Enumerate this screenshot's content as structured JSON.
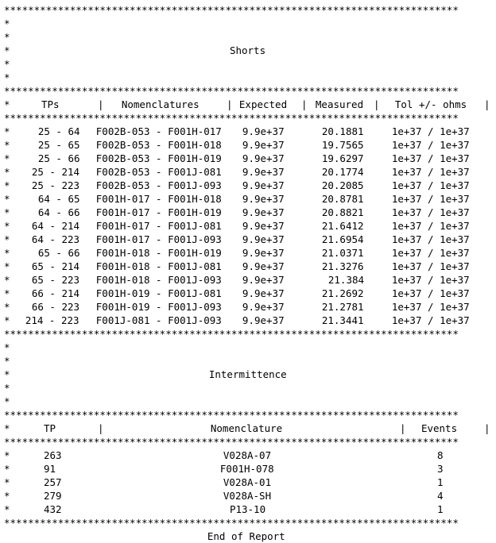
{
  "document": {
    "separator_char": "*",
    "separator_text": "****************************************************************************",
    "row_marker": "*",
    "footer": "End of Report",
    "text_color": "#000000",
    "background_color": "#ffffff"
  },
  "shorts_section": {
    "title": "Shorts",
    "headers": {
      "tps": "TPs",
      "nomenclatures": "Nomenclatures",
      "expected": "Expected",
      "measured": "Measured",
      "tolerance": "Tol +/- ohms"
    },
    "rows": [
      {
        "tps": "25 - 64",
        "nomenclatures": "F002B-053 - F001H-017",
        "expected": "9.9e+37",
        "measured": "20.1881",
        "tolerance": "1e+37 / 1e+37"
      },
      {
        "tps": "25 - 65",
        "nomenclatures": "F002B-053 - F001H-018",
        "expected": "9.9e+37",
        "measured": "19.7565",
        "tolerance": "1e+37 / 1e+37"
      },
      {
        "tps": "25 - 66",
        "nomenclatures": "F002B-053 - F001H-019",
        "expected": "9.9e+37",
        "measured": "19.6297",
        "tolerance": "1e+37 / 1e+37"
      },
      {
        "tps": "25 - 214",
        "nomenclatures": "F002B-053 - F001J-081",
        "expected": "9.9e+37",
        "measured": "20.1774",
        "tolerance": "1e+37 / 1e+37"
      },
      {
        "tps": "25 - 223",
        "nomenclatures": "F002B-053 - F001J-093",
        "expected": "9.9e+37",
        "measured": "20.2085",
        "tolerance": "1e+37 / 1e+37"
      },
      {
        "tps": "64 - 65",
        "nomenclatures": "F001H-017 - F001H-018",
        "expected": "9.9e+37",
        "measured": "20.8781",
        "tolerance": "1e+37 / 1e+37"
      },
      {
        "tps": "64 - 66",
        "nomenclatures": "F001H-017 - F001H-019",
        "expected": "9.9e+37",
        "measured": "20.8821",
        "tolerance": "1e+37 / 1e+37"
      },
      {
        "tps": "64 - 214",
        "nomenclatures": "F001H-017 - F001J-081",
        "expected": "9.9e+37",
        "measured": "21.6412",
        "tolerance": "1e+37 / 1e+37"
      },
      {
        "tps": "64 - 223",
        "nomenclatures": "F001H-017 - F001J-093",
        "expected": "9.9e+37",
        "measured": "21.6954",
        "tolerance": "1e+37 / 1e+37"
      },
      {
        "tps": "65 - 66",
        "nomenclatures": "F001H-018 - F001H-019",
        "expected": "9.9e+37",
        "measured": "21.0371",
        "tolerance": "1e+37 / 1e+37"
      },
      {
        "tps": "65 - 214",
        "nomenclatures": "F001H-018 - F001J-081",
        "expected": "9.9e+37",
        "measured": "21.3276",
        "tolerance": "1e+37 / 1e+37"
      },
      {
        "tps": "65 - 223",
        "nomenclatures": "F001H-018 - F001J-093",
        "expected": "9.9e+37",
        "measured": "21.384",
        "tolerance": "1e+37 / 1e+37"
      },
      {
        "tps": "66 - 214",
        "nomenclatures": "F001H-019 - F001J-081",
        "expected": "9.9e+37",
        "measured": "21.2692",
        "tolerance": "1e+37 / 1e+37"
      },
      {
        "tps": "66 - 223",
        "nomenclatures": "F001H-019 - F001J-093",
        "expected": "9.9e+37",
        "measured": "21.2781",
        "tolerance": "1e+37 / 1e+37"
      },
      {
        "tps": "214 - 223",
        "nomenclatures": "F001J-081 - F001J-093",
        "expected": "9.9e+37",
        "measured": "21.3441",
        "tolerance": "1e+37 / 1e+37"
      }
    ]
  },
  "intermittence_section": {
    "title": "Intermittence",
    "headers": {
      "tp": "TP",
      "nomenclature": "Nomenclature",
      "events": "Events"
    },
    "rows": [
      {
        "tp": "263",
        "nomenclature": "V028A-07",
        "events": "8"
      },
      {
        "tp": "91",
        "nomenclature": "F001H-078",
        "events": "3"
      },
      {
        "tp": "257",
        "nomenclature": "V028A-01",
        "events": "1"
      },
      {
        "tp": "279",
        "nomenclature": "V028A-SH",
        "events": "4"
      },
      {
        "tp": "432",
        "nomenclature": "P13-10",
        "events": "1"
      }
    ]
  }
}
